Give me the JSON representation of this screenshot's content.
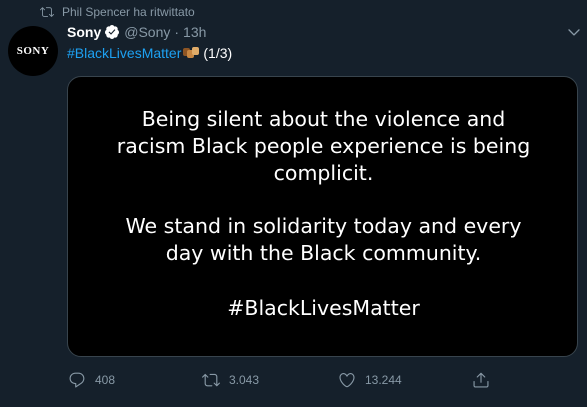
{
  "retweet_context": {
    "text": "Phil Spencer ha ritwittato",
    "icon": "retweet-icon"
  },
  "author": {
    "avatar_text": "SONY",
    "name": "Sony",
    "handle": "@Sony",
    "separator": "·",
    "time": "13h",
    "verified_icon": "verified-badge-icon"
  },
  "tweet": {
    "hashtag": "#BlackLivesMatter",
    "emoji": "raised-fists-icon",
    "count": "(1/3)"
  },
  "media": {
    "line1": "Being silent about the violence and",
    "line2": "racism Black people experience is being",
    "line3": "complicit.",
    "line4": "We stand in solidarity today and every",
    "line5": "day with the Black community.",
    "line6": "#BlackLivesMatter"
  },
  "actions": {
    "reply_count": "408",
    "retweet_count": "3.043",
    "like_count": "13.244",
    "icons": [
      "reply-icon",
      "retweet-icon",
      "like-icon",
      "share-icon"
    ]
  },
  "colors": {
    "background": "#15202b",
    "accent": "#1da1f2",
    "muted": "#8899a6",
    "border": "#38444d"
  }
}
